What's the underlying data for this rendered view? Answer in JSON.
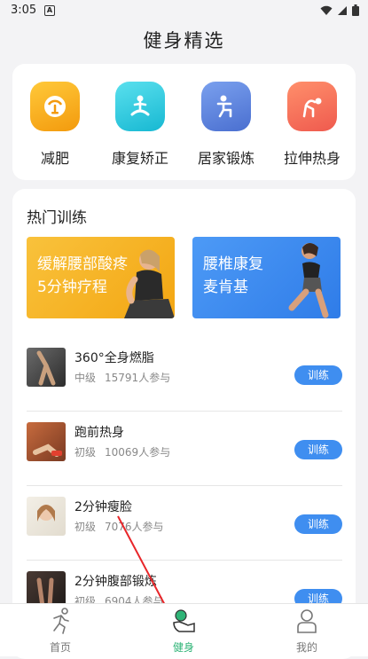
{
  "status": {
    "time": "3:05",
    "notification": "A"
  },
  "header": {
    "title": "健身精选"
  },
  "categories": [
    {
      "label": "减肥",
      "icon": "scale-icon",
      "color": "#f7a417"
    },
    {
      "label": "康复矫正",
      "icon": "meditation-icon",
      "color": "#2bc6dc"
    },
    {
      "label": "居家锻炼",
      "icon": "home-workout-icon",
      "color": "#5b7fd8"
    },
    {
      "label": "拉伸热身",
      "icon": "stretch-icon",
      "color": "#f56a5a"
    }
  ],
  "hot": {
    "title": "热门训练",
    "banners": [
      {
        "text_line1": "缓解腰部酸疼",
        "text_line2": "5分钟疗程",
        "color": "#f5b21e"
      },
      {
        "text_line1": "腰椎康复",
        "text_line2": "麦肯基",
        "color": "#3d8af0"
      }
    ],
    "items": [
      {
        "title": "360°全身燃脂",
        "level": "中级",
        "participants": "15791人参与",
        "button": "训练"
      },
      {
        "title": "跑前热身",
        "level": "初级",
        "participants": "10069人参与",
        "button": "训练"
      },
      {
        "title": "2分钟瘦脸",
        "level": "初级",
        "participants": "7076人参与",
        "button": "训练"
      },
      {
        "title": "2分钟腹部锻炼",
        "level": "初级",
        "participants": "6904人参与",
        "button": "训练"
      }
    ]
  },
  "tabbar": {
    "tabs": [
      {
        "label": "首页",
        "icon": "running-icon"
      },
      {
        "label": "健身",
        "icon": "fitness-icon",
        "active": true
      },
      {
        "label": "我的",
        "icon": "profile-icon"
      }
    ],
    "active_color": "#2fb477"
  }
}
